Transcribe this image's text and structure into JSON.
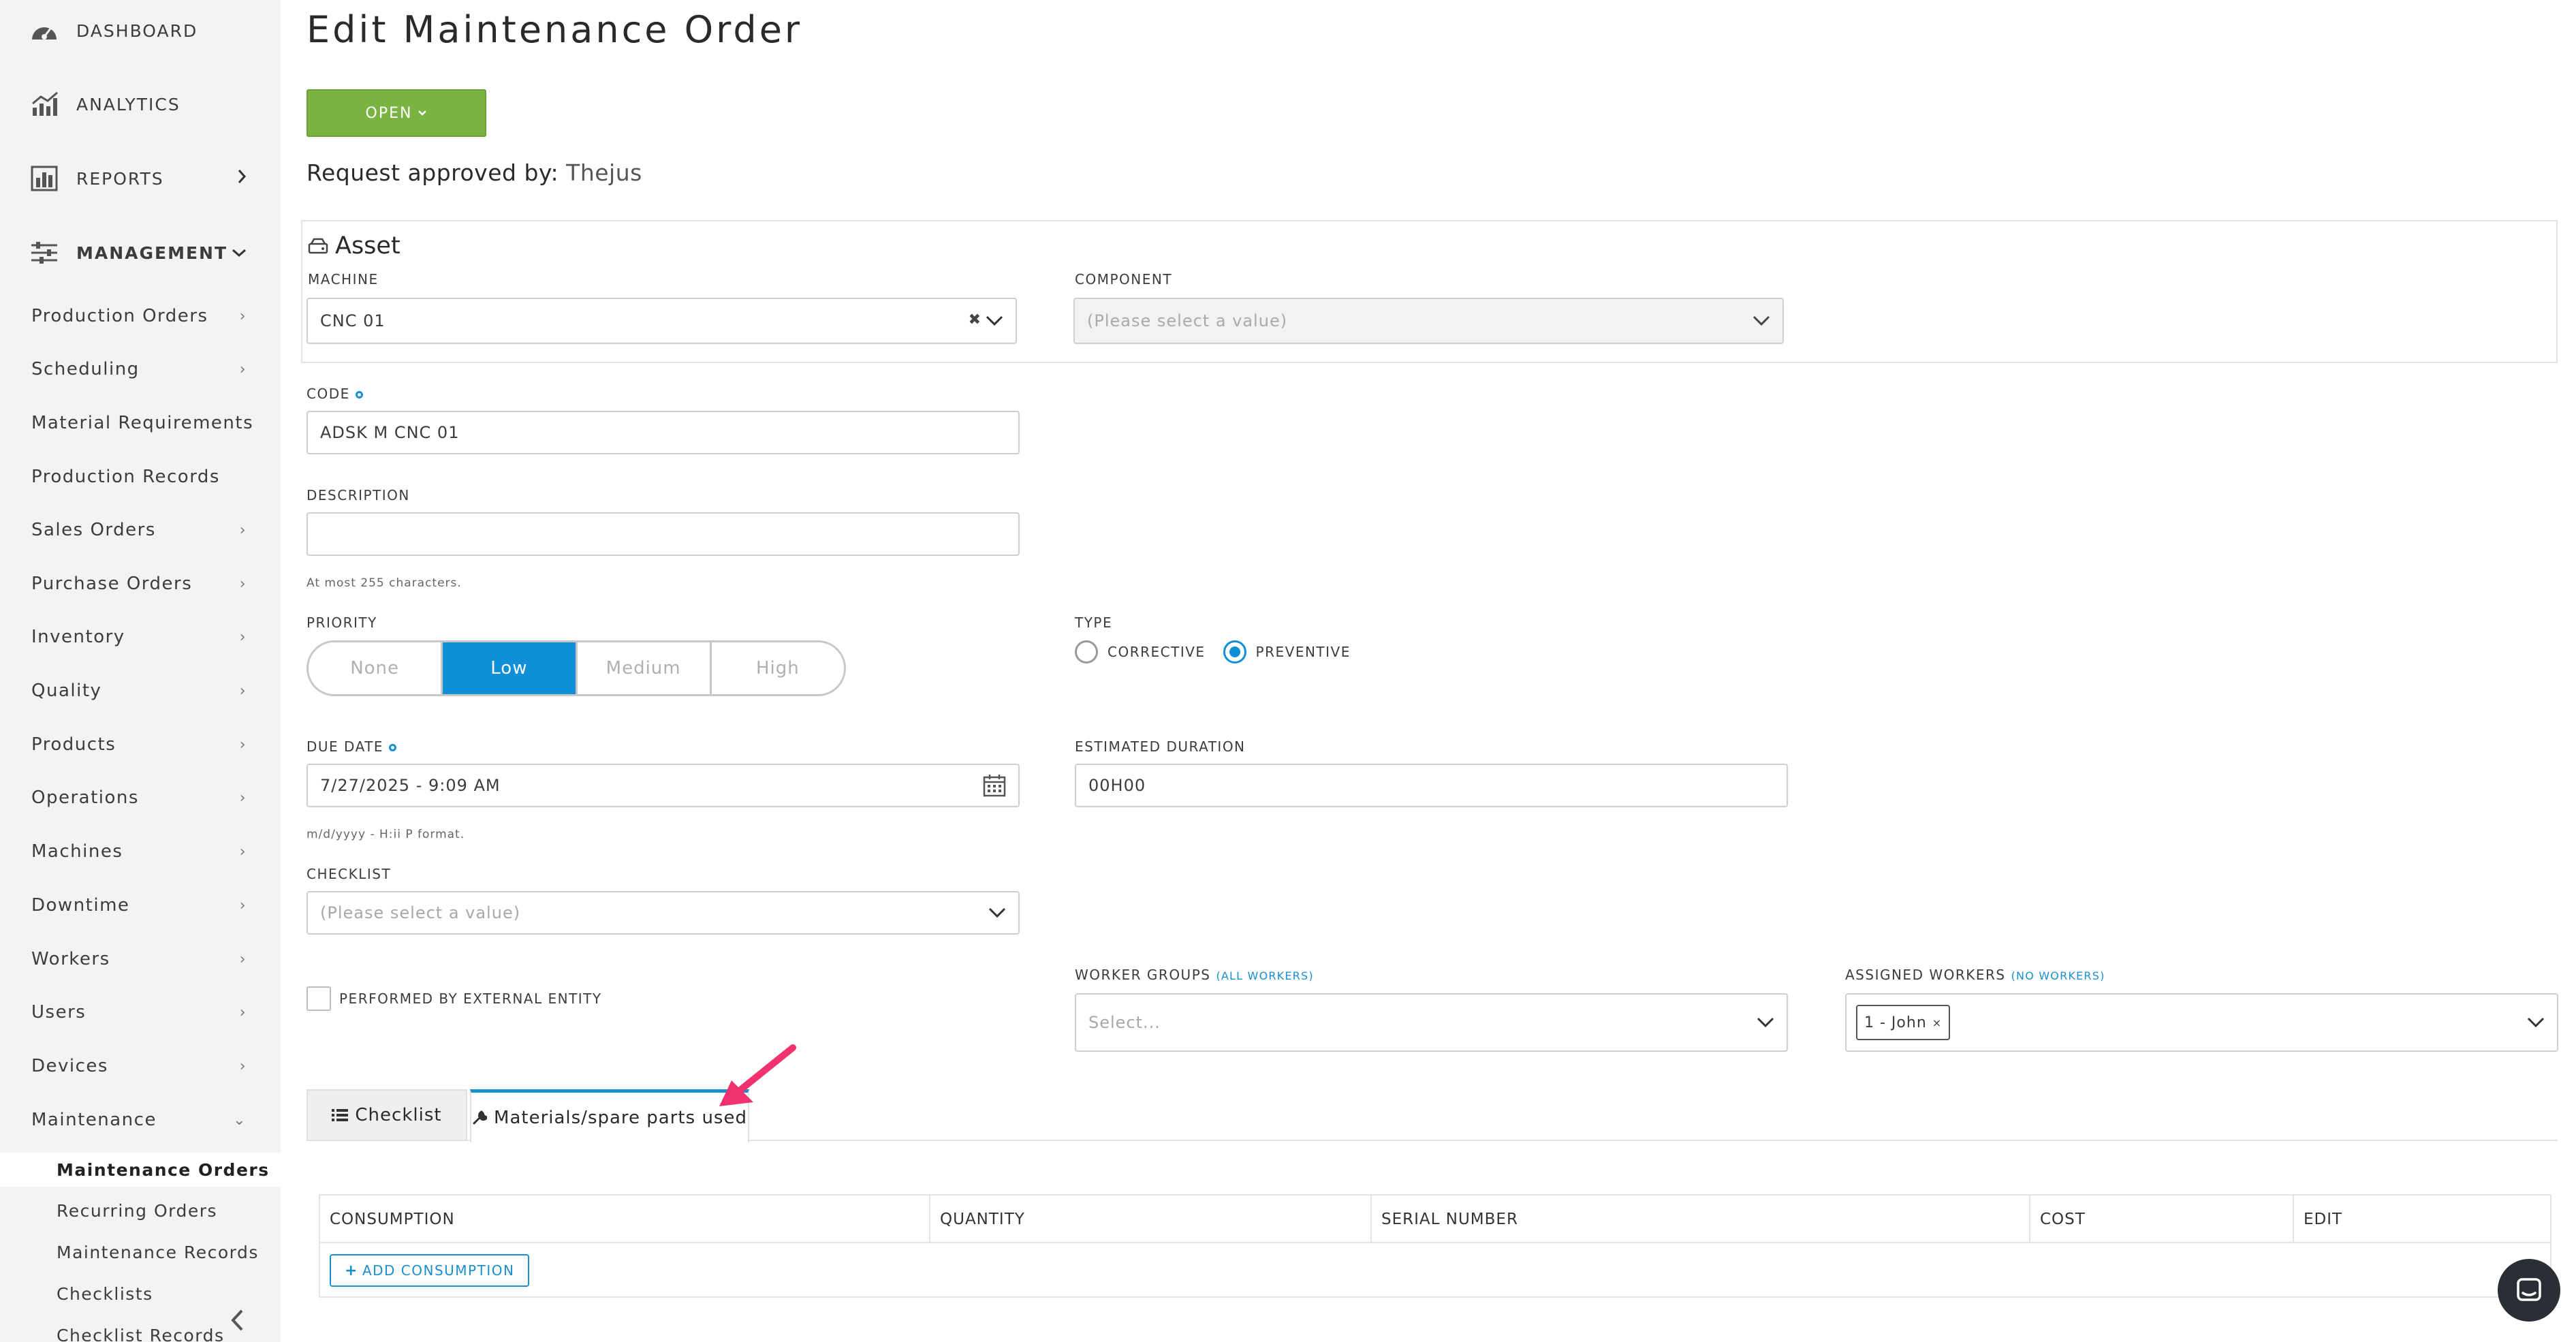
{
  "sidebar": {
    "top": [
      {
        "label": "DASHBOARD",
        "icon": "dashboard-gauge-icon"
      },
      {
        "label": "ANALYTICS",
        "icon": "analytics-chart-icon"
      },
      {
        "label": "REPORTS",
        "icon": "reports-bar-icon"
      },
      {
        "label": "MANAGEMENT",
        "icon": "management-sliders-icon"
      }
    ],
    "management_items": [
      "Production Orders",
      "Scheduling",
      "Material Requirements",
      "Production Records",
      "Sales Orders",
      "Purchase Orders",
      "Inventory",
      "Quality",
      "Products",
      "Operations",
      "Machines",
      "Downtime",
      "Workers",
      "Users",
      "Devices",
      "Maintenance"
    ],
    "maintenance_children": [
      "Maintenance Orders",
      "Recurring Orders",
      "Maintenance Records",
      "Checklists",
      "Checklist Records"
    ],
    "active_child": "Maintenance Orders"
  },
  "page": {
    "title": "Edit Maintenance Order",
    "status_button": "OPEN",
    "approved_label": "Request approved by:",
    "approved_name": "Thejus"
  },
  "asset": {
    "heading": "Asset",
    "machine_label": "MACHINE",
    "machine_value": "CNC 01",
    "component_label": "COMPONENT",
    "component_placeholder": "(Please select a value)"
  },
  "form": {
    "code_label": "CODE",
    "code_value": "ADSK M CNC 01",
    "description_label": "DESCRIPTION",
    "description_value": "",
    "description_hint": "At most 255 characters.",
    "priority_label": "PRIORITY",
    "priority_options": [
      "None",
      "Low",
      "Medium",
      "High"
    ],
    "priority_selected": "Low",
    "type_label": "TYPE",
    "type_options": [
      "CORRECTIVE",
      "PREVENTIVE"
    ],
    "type_selected": "PREVENTIVE",
    "due_date_label": "DUE DATE",
    "due_date_value": "7/27/2025 - 9:09 AM",
    "due_date_hint": "m/d/yyyy - H:ii P format.",
    "duration_label": "ESTIMATED DURATION",
    "duration_value": "00H00",
    "checklist_label": "CHECKLIST",
    "checklist_placeholder": "(Please select a value)",
    "external_label": "PERFORMED BY EXTERNAL ENTITY",
    "worker_groups_label": "WORKER GROUPS",
    "worker_groups_note": "(ALL WORKERS)",
    "worker_groups_placeholder": "Select...",
    "assigned_label": "ASSIGNED WORKERS",
    "assigned_note": "(NO WORKERS)",
    "assigned_tag": "1 - John"
  },
  "tabs": [
    {
      "label": "Checklist",
      "icon": "list-icon",
      "active": false
    },
    {
      "label": "Materials/spare parts used",
      "icon": "wrench-icon",
      "active": true
    }
  ],
  "table": {
    "headers": [
      "CONSUMPTION",
      "QUANTITY",
      "SERIAL NUMBER",
      "COST",
      "EDIT"
    ],
    "add_button": "ADD CONSUMPTION"
  },
  "colors": {
    "accent": "#0e8fd8",
    "status_green": "#7bb342",
    "annotation_arrow": "#f0326e"
  }
}
